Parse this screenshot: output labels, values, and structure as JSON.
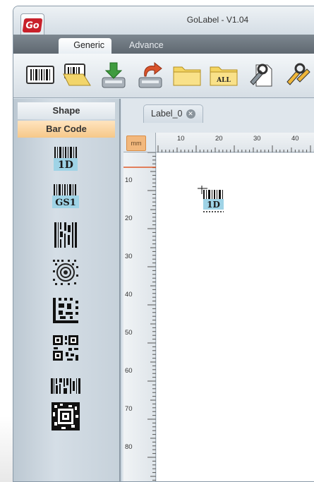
{
  "window": {
    "title": "GoLabel - V1.04",
    "app_icon_text": "Go"
  },
  "tabs": [
    {
      "label": "Generic",
      "active": true
    },
    {
      "label": "Advance",
      "active": false
    }
  ],
  "toolbar": {
    "buttons": [
      {
        "icon": "barcode-label-icon"
      },
      {
        "icon": "open-label-icon"
      },
      {
        "icon": "save-download-icon"
      },
      {
        "icon": "save-upload-icon"
      },
      {
        "icon": "folder-icon"
      },
      {
        "icon": "folder-all-icon",
        "text": "ALL"
      },
      {
        "icon": "printer-setup-icon"
      },
      {
        "icon": "tools-icon"
      }
    ]
  },
  "sidebar": {
    "shape_label": "Shape",
    "barcode_label": "Bar Code",
    "items": [
      {
        "icon": "1d-barcode-icon",
        "text": "1D"
      },
      {
        "icon": "gs1-barcode-icon",
        "text": "GS1"
      },
      {
        "icon": "stacked-barcode-icon"
      },
      {
        "icon": "maxicode-icon"
      },
      {
        "icon": "datamatrix-icon"
      },
      {
        "icon": "qr-code-icon"
      },
      {
        "icon": "pdf417-icon"
      },
      {
        "icon": "aztec-icon"
      }
    ]
  },
  "document": {
    "tab_label": "Label_0",
    "unit": "mm",
    "ruler_top": [
      "10",
      "20",
      "30",
      "40"
    ],
    "ruler_left": [
      "10",
      "20",
      "30",
      "40",
      "50",
      "60",
      "70",
      "80"
    ],
    "placed_object_text": "1D"
  },
  "colors": {
    "accent_orange": "#f6c889",
    "tab_bar": "#6b747c",
    "label_blue": "#9fd3e6"
  }
}
